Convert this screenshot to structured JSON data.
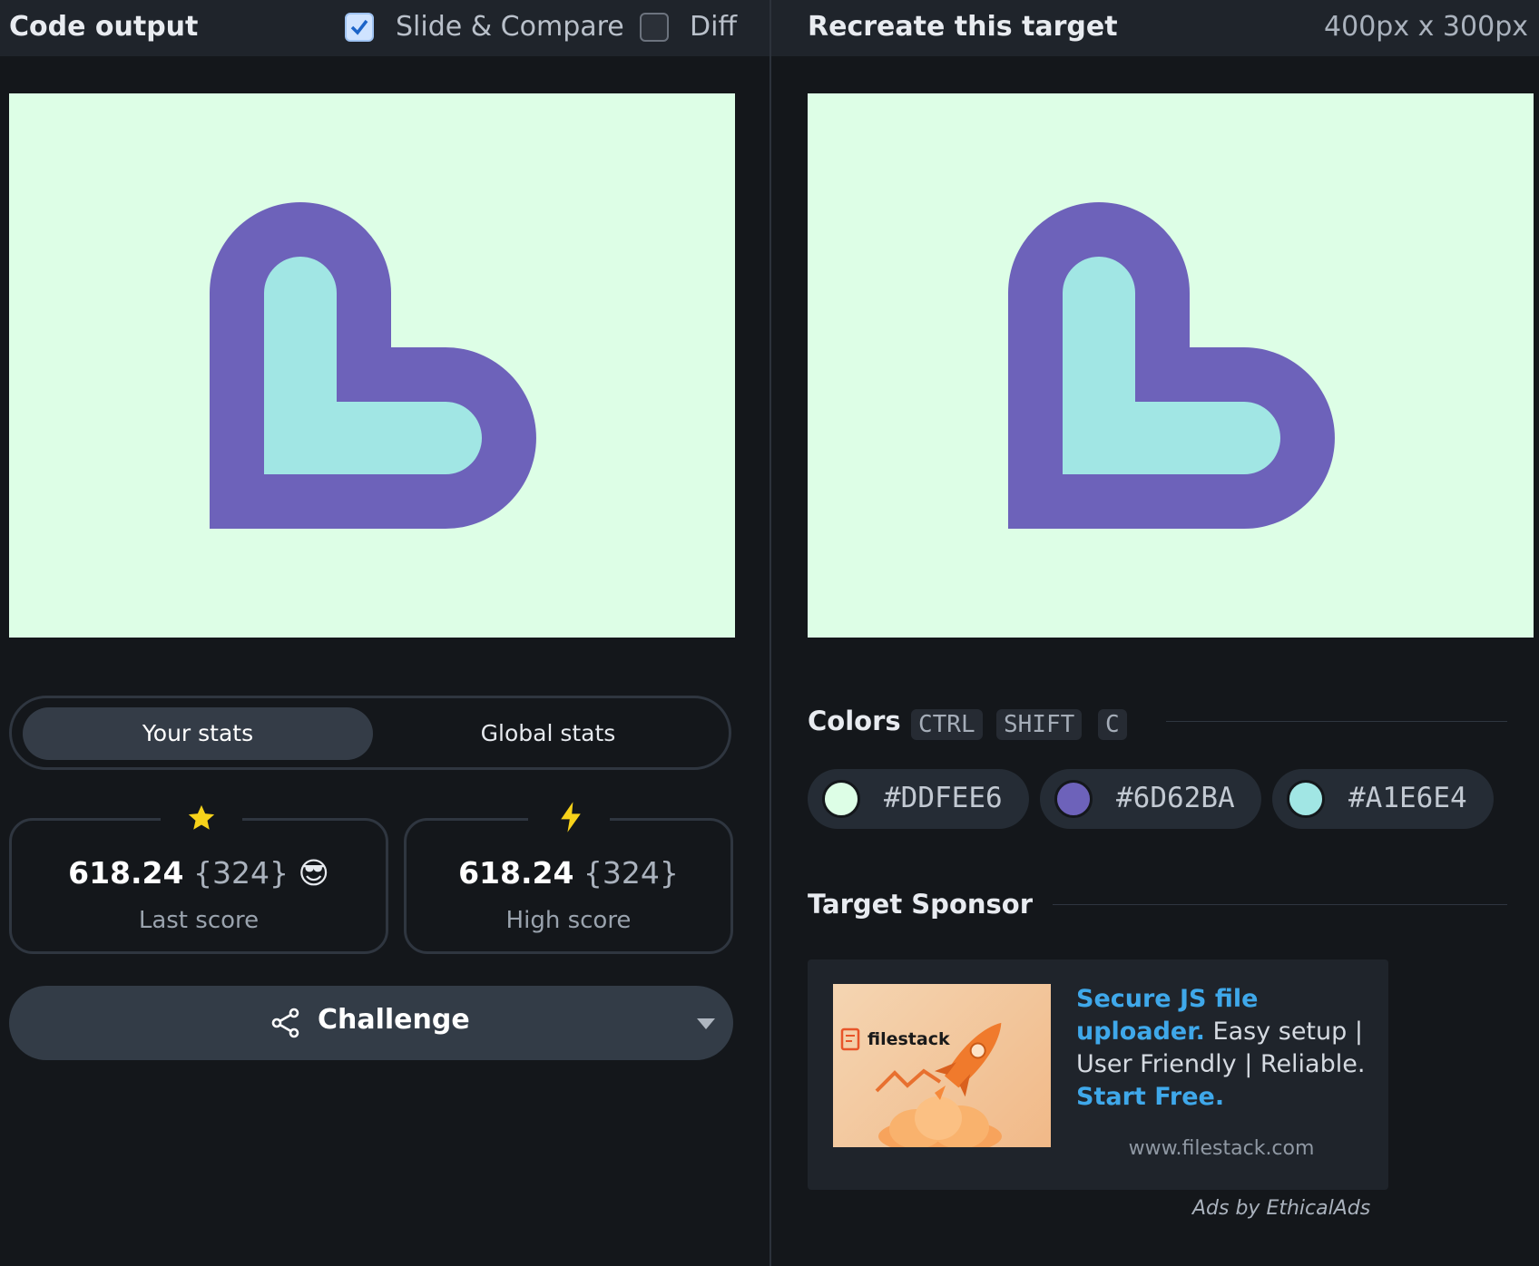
{
  "left": {
    "title": "Code output",
    "slide_compare": {
      "label": "Slide & Compare",
      "checked": true
    },
    "diff": {
      "label": "Diff",
      "checked": false
    },
    "tabs": {
      "your_stats": "Your stats",
      "global_stats": "Global stats"
    },
    "last_score": {
      "value": "618.24",
      "count": "{324}",
      "label": "Last score",
      "emoji": "😎"
    },
    "high_score": {
      "value": "618.24",
      "count": "{324}",
      "label": "High score"
    },
    "challenge_label": "Challenge"
  },
  "right": {
    "title": "Recreate this target",
    "size": "400px x 300px",
    "colors_title": "Colors",
    "shortcut": [
      "CTRL",
      "SHIFT",
      "C"
    ],
    "colors": [
      "#DDFEE6",
      "#6D62BA",
      "#A1E6E4"
    ],
    "sponsor_title": "Target Sponsor",
    "ad": {
      "brand": "filestack",
      "headline": "Secure JS file uploader.",
      "body": " Easy setup | User Friendly | Reliable. ",
      "cta": "Start Free.",
      "url": "www.filestack.com"
    },
    "ads_by": "Ads by EthicalAds"
  },
  "palette": {
    "background": "#DDFEE6",
    "outer": "#6D62BA",
    "inner": "#A1E6E4"
  }
}
